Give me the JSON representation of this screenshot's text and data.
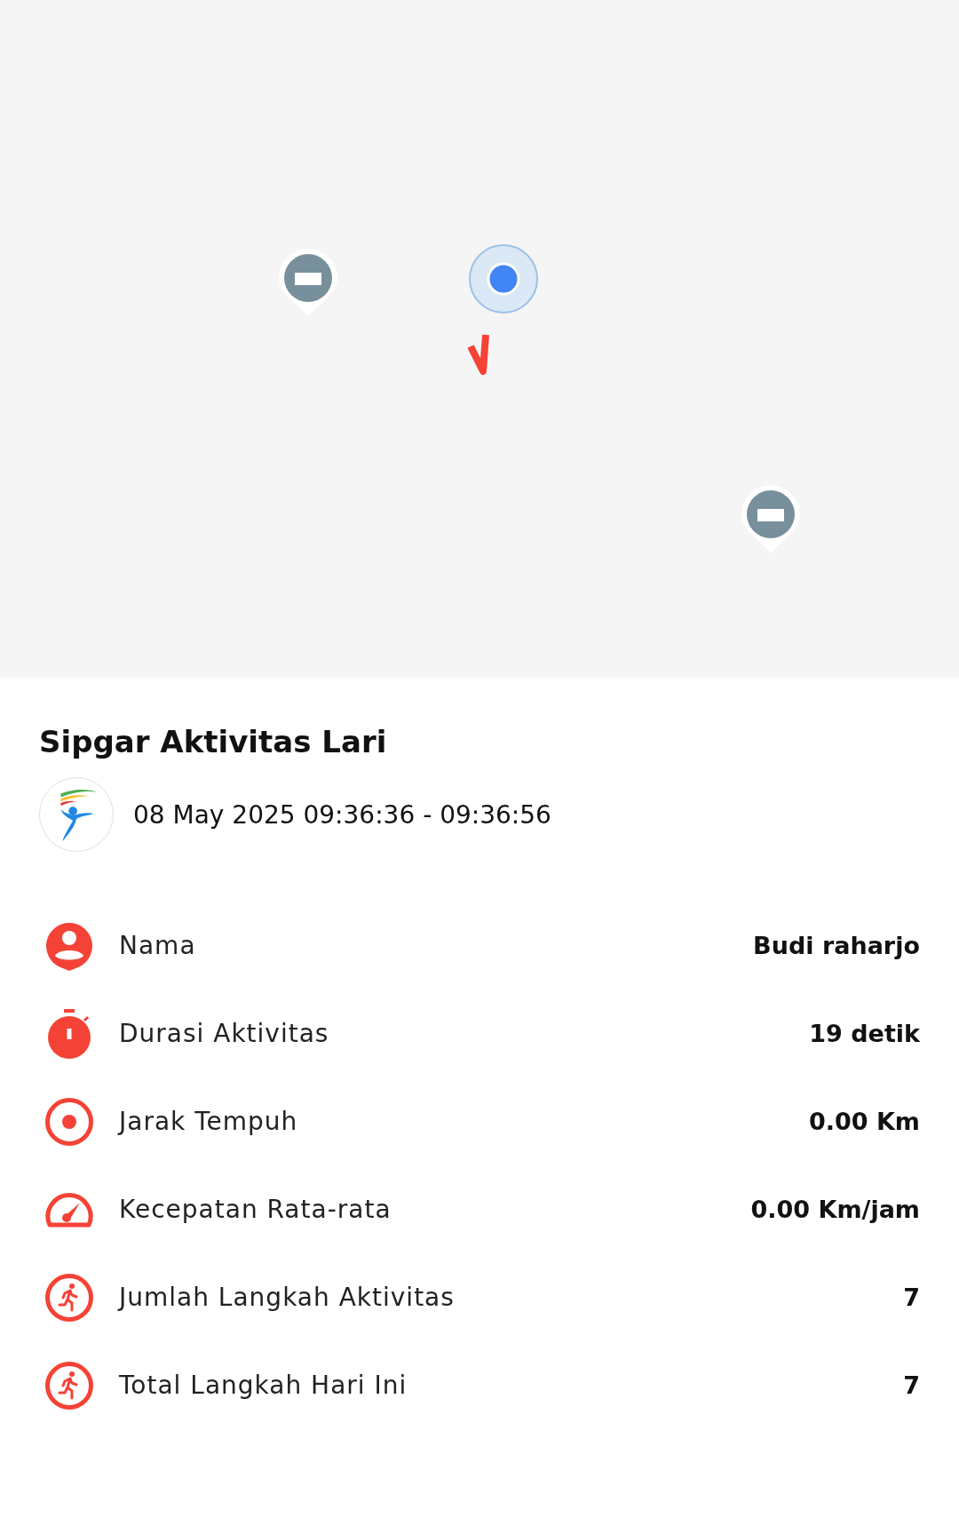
{
  "title": "Sipgar Aktivitas Lari",
  "session": {
    "date_range": "08 May 2025 09:36:36 - 09:36:56"
  },
  "stats": [
    {
      "kind": "person",
      "label": "Nama",
      "value": "Budi raharjo"
    },
    {
      "kind": "stopwatch",
      "label": "Durasi Aktivitas",
      "value": "19 detik"
    },
    {
      "kind": "target",
      "label": "Jarak Tempuh",
      "value": "0.00 Km"
    },
    {
      "kind": "speedometer",
      "label": "Kecepatan Rata-rata",
      "value": "0.00 Km/jam"
    },
    {
      "kind": "running",
      "label": "Jumlah Langkah Aktivitas",
      "value": "7"
    },
    {
      "kind": "running",
      "label": "Total Langkah Hari Ini",
      "value": "7"
    }
  ]
}
